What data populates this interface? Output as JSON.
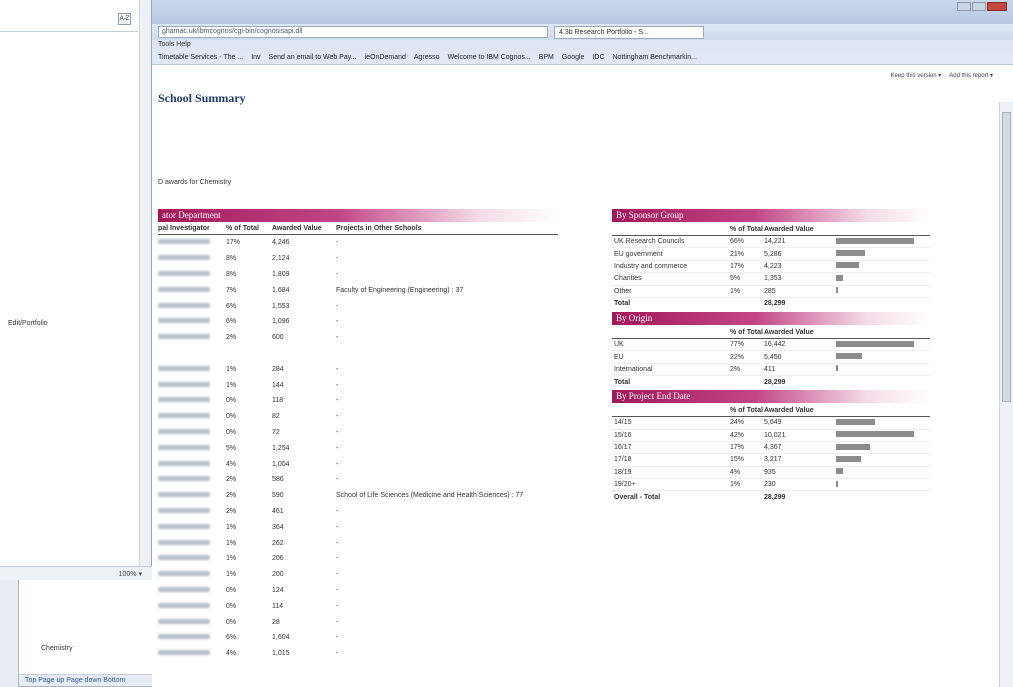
{
  "browser": {
    "address": "ghamac.uk/ibmcognos/cgi-bin/cognosisapi.dll",
    "tab_title": "4.3b Research Portfolio - S...",
    "menu": "Tools   Help",
    "favorites": [
      "Timetable Services - The ...",
      "Inv",
      "Send an email to Web Pay...",
      "ieOnDemand",
      "Agresso",
      "Welcome to IBM Cognos...",
      "BPM",
      "Google",
      "IDC",
      "Nottingham Benchmarkin..."
    ]
  },
  "toolbar": {
    "help": "Keep this version ▾",
    "add_report": "Add this report ▾"
  },
  "left_pane": {
    "az": "A-Z",
    "label": "Edit/Portfolio",
    "zoom": "100% ▾"
  },
  "back_window": {
    "label": "Chemistry",
    "taskbar": "Top   Page up   Page down   Bottom"
  },
  "report": {
    "title": "School Summary",
    "awards_note": "D awards for Chemistry",
    "dept_banner": "ator Department",
    "columns": [
      "pal Investigator",
      "% of Total",
      "Awarded Value",
      "Projects in Other Schools"
    ],
    "rows": [
      {
        "pct": "17%",
        "val": "4,246",
        "other": "-"
      },
      {
        "pct": "8%",
        "val": "2,124",
        "other": "-"
      },
      {
        "pct": "8%",
        "val": "1,809",
        "other": "-"
      },
      {
        "pct": "7%",
        "val": "1,684",
        "other": "Faculty of Engineering (Engineering) : 37"
      },
      {
        "pct": "6%",
        "val": "1,553",
        "other": "-"
      },
      {
        "pct": "6%",
        "val": "1,096",
        "other": "-"
      },
      {
        "pct": "2%",
        "val": "600",
        "other": "-"
      },
      {
        "pct": "",
        "val": "",
        "other": ""
      },
      {
        "pct": "1%",
        "val": "284",
        "other": "-"
      },
      {
        "pct": "1%",
        "val": "144",
        "other": "-"
      },
      {
        "pct": "0%",
        "val": "118",
        "other": "-"
      },
      {
        "pct": "0%",
        "val": "82",
        "other": "-"
      },
      {
        "pct": "0%",
        "val": "72",
        "other": "-"
      },
      {
        "pct": "5%",
        "val": "1,254",
        "other": "-"
      },
      {
        "pct": "4%",
        "val": "1,004",
        "other": "-"
      },
      {
        "pct": "2%",
        "val": "586",
        "other": "-"
      },
      {
        "pct": "2%",
        "val": "590",
        "other": "School of Life Sciences (Medicine and Health Sciences) : 77"
      },
      {
        "pct": "2%",
        "val": "461",
        "other": "-"
      },
      {
        "pct": "1%",
        "val": "364",
        "other": "-"
      },
      {
        "pct": "1%",
        "val": "262",
        "other": "-"
      },
      {
        "pct": "1%",
        "val": "206",
        "other": "-"
      },
      {
        "pct": "1%",
        "val": "200",
        "other": "-"
      },
      {
        "pct": "0%",
        "val": "124",
        "other": "-"
      },
      {
        "pct": "0%",
        "val": "114",
        "other": "-"
      },
      {
        "pct": "0%",
        "val": "28",
        "other": "-"
      },
      {
        "pct": "6%",
        "val": "1,604",
        "other": "-"
      },
      {
        "pct": "4%",
        "val": "1,015",
        "other": "-"
      }
    ],
    "col_pct": "% of Total",
    "col_val": "Awarded Value",
    "sponsor": {
      "banner": "By Sponsor Group",
      "rows": [
        {
          "name": "UK Research Councils",
          "pct": "66%",
          "val": "14,221",
          "frac": 1.0
        },
        {
          "name": "EU government",
          "pct": "21%",
          "val": "5,286",
          "frac": 0.37
        },
        {
          "name": "Industry and commerce",
          "pct": "17%",
          "val": "4,223",
          "frac": 0.3
        },
        {
          "name": "Charities",
          "pct": "5%",
          "val": "1,353",
          "frac": 0.09
        },
        {
          "name": "Other",
          "pct": "1%",
          "val": "285",
          "frac": 0.02
        }
      ],
      "total_label": "Total",
      "total": "28,299"
    },
    "origin": {
      "banner": "By Origin",
      "rows": [
        {
          "name": "UK",
          "pct": "77%",
          "val": "16,442",
          "frac": 1.0
        },
        {
          "name": "EU",
          "pct": "22%",
          "val": "5,450",
          "frac": 0.33
        },
        {
          "name": "International",
          "pct": "2%",
          "val": "411",
          "frac": 0.03
        }
      ],
      "total_label": "Total",
      "total": "28,299"
    },
    "enddate": {
      "banner": "By Project End Date",
      "rows": [
        {
          "name": "14/15",
          "pct": "24%",
          "val": "5,649",
          "frac": 0.5
        },
        {
          "name": "15/16",
          "pct": "42%",
          "val": "10,021",
          "frac": 1.0
        },
        {
          "name": "16/17",
          "pct": "17%",
          "val": "4,367",
          "frac": 0.43
        },
        {
          "name": "17/18",
          "pct": "15%",
          "val": "3,217",
          "frac": 0.32
        },
        {
          "name": "18/19",
          "pct": "4%",
          "val": "935",
          "frac": 0.09
        },
        {
          "name": "19/20+",
          "pct": "1%",
          "val": "230",
          "frac": 0.02
        }
      ],
      "total_label": "Overall - Total",
      "total": "28,299"
    }
  }
}
